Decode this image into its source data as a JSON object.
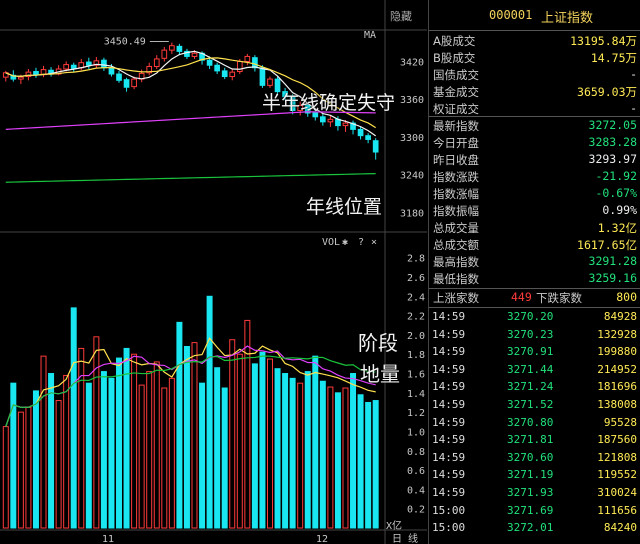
{
  "window": {
    "hide_button": "隐藏"
  },
  "chart": {
    "ma_label": "MA",
    "high_marker": "3450.49",
    "y_price_ticks": [
      "3420",
      "3360",
      "3300",
      "3240",
      "3180"
    ],
    "vol_label": "VOL",
    "vol_ticks": [
      "2.8",
      "2.6",
      "2.4",
      "2.2",
      "2.0",
      "1.8",
      "1.6",
      "1.4",
      "1.2",
      "1.0",
      "0.8",
      "0.6",
      "0.4",
      "0.2"
    ],
    "vol_unit": "X亿",
    "x_labels": [
      "11",
      "12"
    ],
    "bottom_tabs": [
      "日",
      "线"
    ],
    "annotations": {
      "half_year": "半年线确定失守",
      "year_line": "年线位置",
      "stage_volume_1": "阶段",
      "stage_volume_2": "地量"
    },
    "colors": {
      "up": "#ff3b3b",
      "down": "#19e6f0",
      "ma_short": "#f4f4f4",
      "ma_mid": "#ffe14d",
      "ma_long": "#e040fb",
      "ma_year": "#19c43c"
    },
    "candles": [
      [
        3395,
        3402,
        3388,
        3405
      ],
      [
        3398,
        3392,
        3388,
        3406
      ],
      [
        3392,
        3395,
        3384,
        3399
      ],
      [
        3396,
        3403,
        3390,
        3408
      ],
      [
        3404,
        3399,
        3394,
        3410
      ],
      [
        3399,
        3407,
        3395,
        3413
      ],
      [
        3406,
        3400,
        3396,
        3411
      ],
      [
        3400,
        3408,
        3398,
        3414
      ],
      [
        3408,
        3415,
        3404,
        3420
      ],
      [
        3414,
        3409,
        3403,
        3418
      ],
      [
        3410,
        3418,
        3406,
        3424
      ],
      [
        3419,
        3414,
        3408,
        3426
      ],
      [
        3414,
        3421,
        3410,
        3427
      ],
      [
        3422,
        3410,
        3405,
        3426
      ],
      [
        3410,
        3400,
        3396,
        3416
      ],
      [
        3400,
        3390,
        3386,
        3405
      ],
      [
        3391,
        3379,
        3372,
        3394
      ],
      [
        3380,
        3392,
        3376,
        3396
      ],
      [
        3392,
        3401,
        3387,
        3407
      ],
      [
        3402,
        3412,
        3398,
        3418
      ],
      [
        3412,
        3424,
        3408,
        3430
      ],
      [
        3425,
        3438,
        3420,
        3443
      ],
      [
        3438,
        3445,
        3432,
        3450
      ],
      [
        3444,
        3436,
        3430,
        3448
      ],
      [
        3436,
        3428,
        3424,
        3440
      ],
      [
        3428,
        3433,
        3424,
        3438
      ],
      [
        3433,
        3422,
        3415,
        3436
      ],
      [
        3422,
        3414,
        3408,
        3428
      ],
      [
        3414,
        3405,
        3400,
        3418
      ],
      [
        3405,
        3396,
        3392,
        3410
      ],
      [
        3396,
        3403,
        3390,
        3408
      ],
      [
        3404,
        3420,
        3400,
        3424
      ],
      [
        3420,
        3428,
        3414,
        3432
      ],
      [
        3426,
        3410,
        3404,
        3430
      ],
      [
        3410,
        3382,
        3378,
        3414
      ],
      [
        3382,
        3392,
        3378,
        3396
      ],
      [
        3392,
        3372,
        3366,
        3396
      ],
      [
        3372,
        3364,
        3358,
        3378
      ],
      [
        3364,
        3342,
        3336,
        3368
      ],
      [
        3342,
        3350,
        3334,
        3356
      ],
      [
        3350,
        3338,
        3332,
        3354
      ],
      [
        3338,
        3332,
        3326,
        3344
      ],
      [
        3332,
        3324,
        3318,
        3338
      ],
      [
        3324,
        3328,
        3316,
        3334
      ],
      [
        3328,
        3318,
        3310,
        3333
      ],
      [
        3318,
        3322,
        3308,
        3327
      ],
      [
        3322,
        3312,
        3304,
        3326
      ],
      [
        3312,
        3302,
        3296,
        3317
      ],
      [
        3302,
        3296,
        3290,
        3306
      ],
      [
        3294,
        3276,
        3264,
        3298
      ]
    ],
    "volumes": [
      1.05,
      1.5,
      1.2,
      1.25,
      1.42,
      1.78,
      1.6,
      1.32,
      1.58,
      2.28,
      1.86,
      1.5,
      1.98,
      1.62,
      1.55,
      1.76,
      1.86,
      1.8,
      1.48,
      1.62,
      1.72,
      1.45,
      1.55,
      2.13,
      1.88,
      1.92,
      1.5,
      2.4,
      1.66,
      1.45,
      1.95,
      1.8,
      2.15,
      1.7,
      1.82,
      1.75,
      1.65,
      1.6,
      1.55,
      1.5,
      1.62,
      1.78,
      1.52,
      1.46,
      1.4,
      1.45,
      1.6,
      1.38,
      1.3,
      1.32
    ]
  },
  "panel": {
    "code": "000001",
    "name": "上证指数",
    "stats": [
      {
        "label": "A股成交",
        "value": "13195.84万",
        "color": "yellow"
      },
      {
        "label": "B股成交",
        "value": "14.75万",
        "color": "yellow"
      },
      {
        "label": "国债成交",
        "value": "-",
        "color": "white"
      },
      {
        "label": "基金成交",
        "value": "3659.03万",
        "color": "yellow"
      },
      {
        "label": "权证成交",
        "value": "-",
        "color": "white"
      },
      {
        "label": "最新指数",
        "value": "3272.05",
        "color": "green"
      },
      {
        "label": "今日开盘",
        "value": "3283.28",
        "color": "green"
      },
      {
        "label": "昨日收盘",
        "value": "3293.97",
        "color": "white"
      },
      {
        "label": "指数涨跌",
        "value": "-21.92",
        "color": "green"
      },
      {
        "label": "指数涨幅",
        "value": "-0.67%",
        "color": "green"
      },
      {
        "label": "指数振幅",
        "value": "0.99%",
        "color": "white"
      },
      {
        "label": "总成交量",
        "value": "1.32亿",
        "color": "yellow"
      },
      {
        "label": "总成交额",
        "value": "1617.65亿",
        "color": "yellow"
      },
      {
        "label": "最高指数",
        "value": "3291.28",
        "color": "green"
      },
      {
        "label": "最低指数",
        "value": "3259.16",
        "color": "green"
      }
    ],
    "rise_label": "上涨家数",
    "rise_count": "449",
    "fall_label": "下跌家数",
    "fall_count": "800",
    "ticks": [
      {
        "time": "14:59",
        "price": "3270.20",
        "vol": "84928"
      },
      {
        "time": "14:59",
        "price": "3270.23",
        "vol": "132928"
      },
      {
        "time": "14:59",
        "price": "3270.91",
        "vol": "199880"
      },
      {
        "time": "14:59",
        "price": "3271.44",
        "vol": "214952"
      },
      {
        "time": "14:59",
        "price": "3271.24",
        "vol": "181696"
      },
      {
        "time": "14:59",
        "price": "3271.52",
        "vol": "138008"
      },
      {
        "time": "14:59",
        "price": "3270.80",
        "vol": "95528"
      },
      {
        "time": "14:59",
        "price": "3271.81",
        "vol": "187560"
      },
      {
        "time": "14:59",
        "price": "3270.60",
        "vol": "121808"
      },
      {
        "time": "14:59",
        "price": "3271.19",
        "vol": "119552"
      },
      {
        "time": "14:59",
        "price": "3271.93",
        "vol": "310024"
      },
      {
        "time": "15:00",
        "price": "3271.69",
        "vol": "111656"
      },
      {
        "time": "15:00",
        "price": "3272.01",
        "vol": "84240"
      }
    ]
  }
}
